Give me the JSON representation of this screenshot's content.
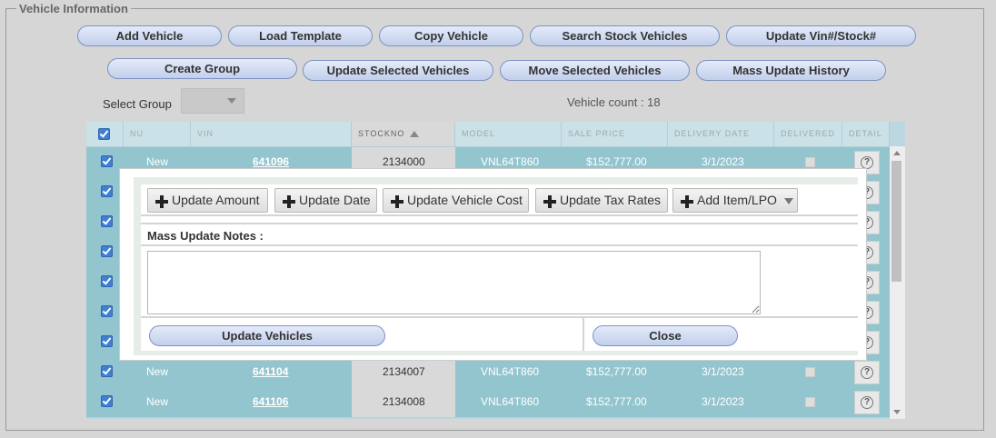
{
  "section": {
    "legend": "Vehicle Information"
  },
  "toolbar": {
    "row1": [
      "Add Vehicle",
      "Load Template",
      "Copy Vehicle",
      "Search Stock Vehicles",
      "Update Vin#/Stock#"
    ],
    "row2": [
      "Create Group",
      "Update Selected Vehicles",
      "Move Selected Vehicles",
      "Mass Update History"
    ]
  },
  "group": {
    "label": "Select Group",
    "value": ""
  },
  "vehicle_count": "Vehicle count : 18",
  "grid": {
    "columns": [
      "NU",
      "VIN",
      "STOCKNO",
      "MODEL",
      "SALE PRICE",
      "DELIVERY DATE",
      "DELIVERED",
      "DETAIL"
    ],
    "rows": [
      {
        "nu": "New",
        "vin": "641096",
        "stockno": "2134000",
        "model": "VNL64T860",
        "price": "$152,777.00",
        "date": "3/1/2023"
      },
      {
        "nu": "",
        "vin": "",
        "stockno": "",
        "model": "",
        "price": "",
        "date": ""
      },
      {
        "nu": "",
        "vin": "",
        "stockno": "",
        "model": "",
        "price": "",
        "date": ""
      },
      {
        "nu": "",
        "vin": "",
        "stockno": "",
        "model": "",
        "price": "",
        "date": ""
      },
      {
        "nu": "",
        "vin": "",
        "stockno": "",
        "model": "",
        "price": "",
        "date": ""
      },
      {
        "nu": "",
        "vin": "",
        "stockno": "",
        "model": "",
        "price": "",
        "date": ""
      },
      {
        "nu": "",
        "vin": "",
        "stockno": "",
        "model": "",
        "price": "",
        "date": ""
      },
      {
        "nu": "New",
        "vin": "641104",
        "stockno": "2134007",
        "model": "VNL64T860",
        "price": "$152,777.00",
        "date": "3/1/2023"
      },
      {
        "nu": "New",
        "vin": "641106",
        "stockno": "2134008",
        "model": "VNL64T860",
        "price": "$152,777.00",
        "date": "3/1/2023"
      }
    ]
  },
  "dialog": {
    "buttons": [
      "Update Amount",
      "Update Date",
      "Update Vehicle Cost",
      "Update Tax Rates",
      "Add Item/LPO"
    ],
    "notes_label": "Mass Update Notes :",
    "notes_value": "",
    "submit": "Update Vehicles",
    "close": "Close"
  },
  "colors": {
    "accent": "#3f7fd4",
    "row": "#93c5cf",
    "header": "#cbe1e8"
  }
}
